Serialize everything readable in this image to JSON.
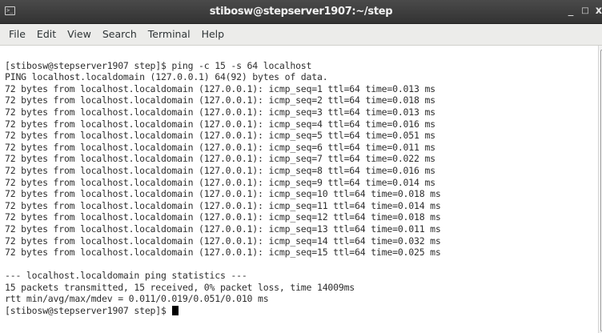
{
  "window": {
    "title": "stibosw@stepserver1907:~/step",
    "icon": "terminal-icon",
    "controls": {
      "minimize": "_",
      "maximize": "□",
      "close": "x"
    }
  },
  "menu": [
    "File",
    "Edit",
    "View",
    "Search",
    "Terminal",
    "Help"
  ],
  "terminal": {
    "lines": [
      "[stibosw@stepserver1907 step]$ ping -c 15 -s 64 localhost",
      "PING localhost.localdomain (127.0.0.1) 64(92) bytes of data.",
      "72 bytes from localhost.localdomain (127.0.0.1): icmp_seq=1 ttl=64 time=0.013 ms",
      "72 bytes from localhost.localdomain (127.0.0.1): icmp_seq=2 ttl=64 time=0.018 ms",
      "72 bytes from localhost.localdomain (127.0.0.1): icmp_seq=3 ttl=64 time=0.013 ms",
      "72 bytes from localhost.localdomain (127.0.0.1): icmp_seq=4 ttl=64 time=0.016 ms",
      "72 bytes from localhost.localdomain (127.0.0.1): icmp_seq=5 ttl=64 time=0.051 ms",
      "72 bytes from localhost.localdomain (127.0.0.1): icmp_seq=6 ttl=64 time=0.011 ms",
      "72 bytes from localhost.localdomain (127.0.0.1): icmp_seq=7 ttl=64 time=0.022 ms",
      "72 bytes from localhost.localdomain (127.0.0.1): icmp_seq=8 ttl=64 time=0.016 ms",
      "72 bytes from localhost.localdomain (127.0.0.1): icmp_seq=9 ttl=64 time=0.014 ms",
      "72 bytes from localhost.localdomain (127.0.0.1): icmp_seq=10 ttl=64 time=0.018 ms",
      "72 bytes from localhost.localdomain (127.0.0.1): icmp_seq=11 ttl=64 time=0.014 ms",
      "72 bytes from localhost.localdomain (127.0.0.1): icmp_seq=12 ttl=64 time=0.018 ms",
      "72 bytes from localhost.localdomain (127.0.0.1): icmp_seq=13 ttl=64 time=0.011 ms",
      "72 bytes from localhost.localdomain (127.0.0.1): icmp_seq=14 ttl=64 time=0.032 ms",
      "72 bytes from localhost.localdomain (127.0.0.1): icmp_seq=15 ttl=64 time=0.025 ms",
      "",
      "--- localhost.localdomain ping statistics ---",
      "15 packets transmitted, 15 received, 0% packet loss, time 14009ms",
      "rtt min/avg/max/mdev = 0.011/0.019/0.051/0.010 ms",
      "[stibosw@stepserver1907 step]$ "
    ]
  }
}
